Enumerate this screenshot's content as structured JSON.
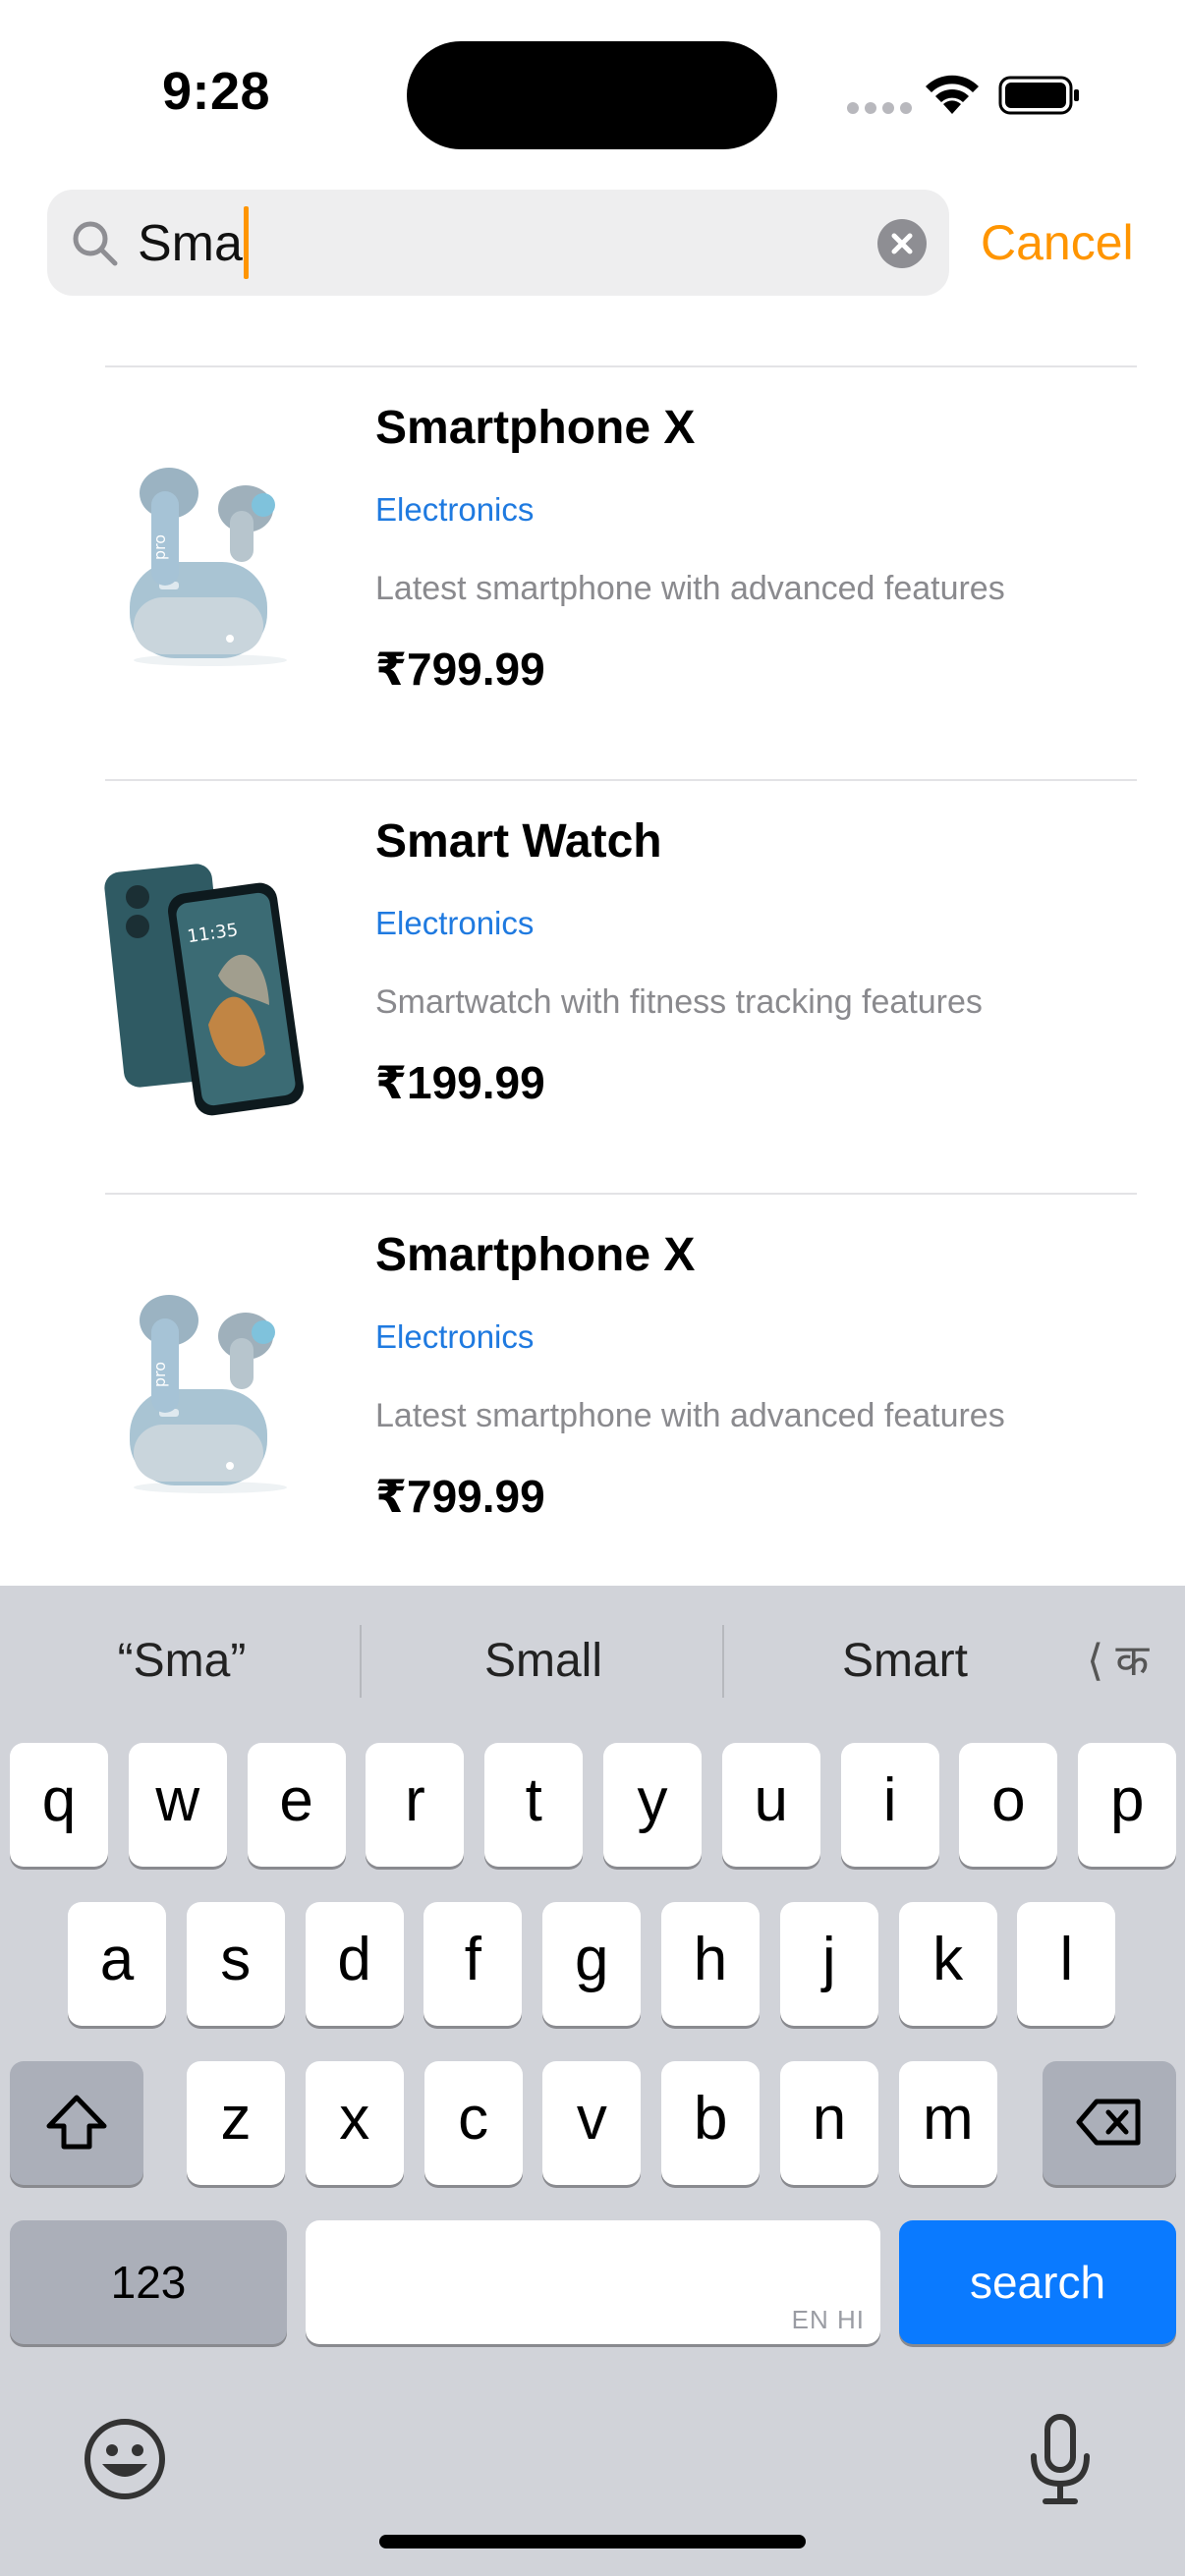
{
  "status_bar": {
    "time": "9:28",
    "icons": [
      "signal-dots-icon",
      "wifi-icon",
      "battery-icon"
    ]
  },
  "search": {
    "query": "Sma",
    "cancel_label": "Cancel",
    "accent_color": "#ff9500"
  },
  "results": [
    {
      "image": "earbuds-image",
      "title": "Smartphone X",
      "category": "Electronics",
      "description": "Latest smartphone with advanced features",
      "price": "₹799.99"
    },
    {
      "image": "phone-image",
      "title": "Smart Watch",
      "category": "Electronics",
      "description": "Smartwatch with fitness tracking features",
      "price": "₹199.99"
    },
    {
      "image": "earbuds-image",
      "title": "Smartphone X",
      "category": "Electronics",
      "description": "Latest smartphone with advanced features",
      "price": "₹799.99"
    }
  ],
  "keyboard": {
    "suggestions": [
      "“Sma”",
      "Small",
      "Smart"
    ],
    "lang_switch": "⟨ क",
    "row1": [
      "q",
      "w",
      "e",
      "r",
      "t",
      "y",
      "u",
      "i",
      "o",
      "p"
    ],
    "row2": [
      "a",
      "s",
      "d",
      "f",
      "g",
      "h",
      "j",
      "k",
      "l"
    ],
    "row3": [
      "z",
      "x",
      "c",
      "v",
      "b",
      "n",
      "m"
    ],
    "numbers_label": "123",
    "space_hint": "EN HI",
    "search_label": "search",
    "action_color": "#0a7aff"
  }
}
